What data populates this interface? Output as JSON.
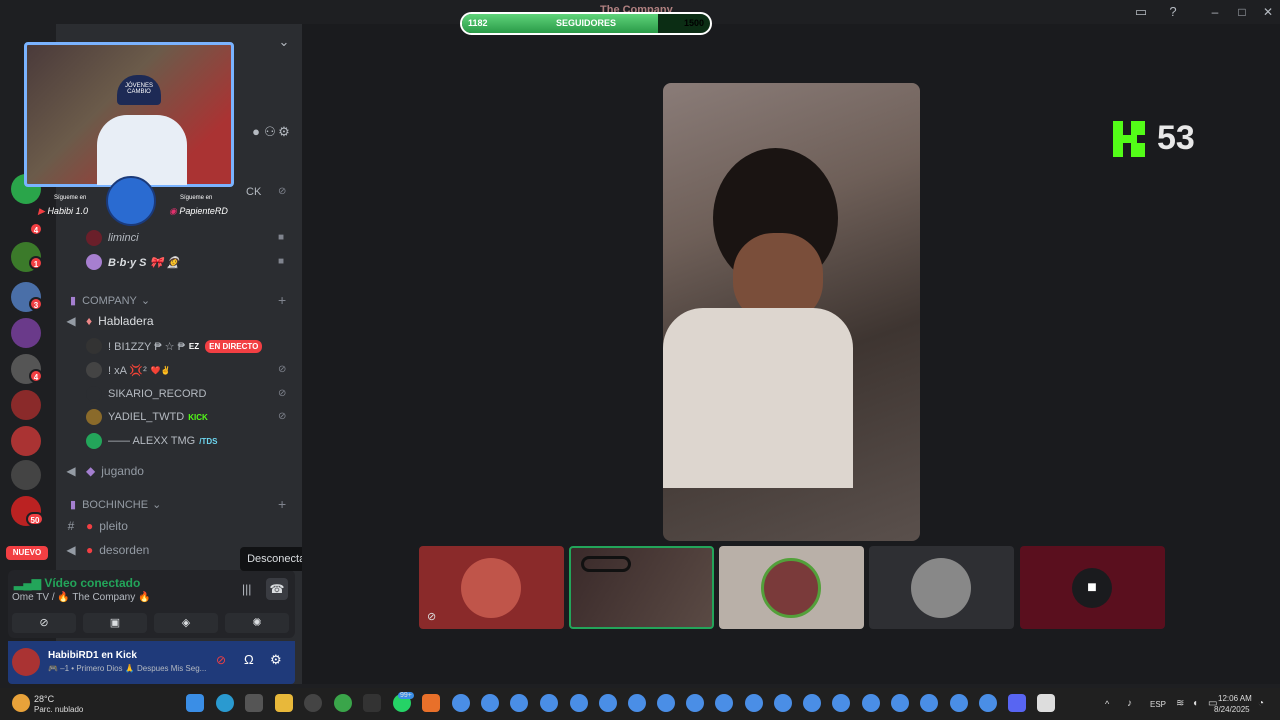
{
  "window": {
    "title": "The Company",
    "controls": [
      "minimize-icon",
      "maximize-icon",
      "close-icon"
    ]
  },
  "followers": {
    "current": "1182",
    "label": "SEGUIDORES",
    "goal": "1500",
    "progress": 0.79
  },
  "rail": {
    "badges": [
      "4",
      "1",
      "3",
      "4",
      "50"
    ],
    "nuevo_label": "NUEVO"
  },
  "webcam": {
    "follow_left_caption": "Sígueme en",
    "follow_left": "Habibi 1.0",
    "follow_right_caption": "Sígueme en",
    "follow_right": "PapienteRD",
    "hat_text": "JÓVENES CAMBIO"
  },
  "sidebar": {
    "partial_top": "CK",
    "users_top": [
      {
        "name": "liminci"
      },
      {
        "name": "B·b·y S 🎀 👩‍🚀"
      }
    ],
    "categories": [
      {
        "label": "COMPANY"
      },
      {
        "label": "BOCHINCHE"
      }
    ],
    "channels": {
      "hababladera": "Habladera",
      "jugando": "jugando",
      "pleito": "pleito",
      "desorden": "desorden"
    },
    "voice_users": [
      {
        "name": "! BI1ZZY ₱ ☆ ₱",
        "tag": "EZ",
        "live": "EN DIRECTO"
      },
      {
        "name": "! xA 💢²",
        "tag": "❤️✌"
      },
      {
        "name": "SIKARIO_RECORD"
      },
      {
        "name": "YADIEL_TWTD",
        "tag": "KICK"
      },
      {
        "name": "—— ALEXX TMG",
        "tag": "/TDS"
      }
    ]
  },
  "voice_panel": {
    "status": "Vídeo conectado",
    "location": "Ome TV / 🔥 The Company 🔥",
    "tooltip": "Desconectar"
  },
  "user_panel": {
    "name": "HabibiRD1 en Kick",
    "status": "🎮 –1 • Primero Dios 🙏 Despues Mis Seg..."
  },
  "stage": {
    "kick_count": "53"
  },
  "taskbar": {
    "weather_temp": "28°C",
    "weather_desc": "Parc. nublado",
    "lang": "ESP",
    "time": "12:06 AM",
    "date": "8/24/2025",
    "badge": "99+"
  },
  "colors": {
    "accent": "#5865f2",
    "kick_green": "#53fc18",
    "live_red": "#f23f43",
    "connected_green": "#23a55a"
  }
}
